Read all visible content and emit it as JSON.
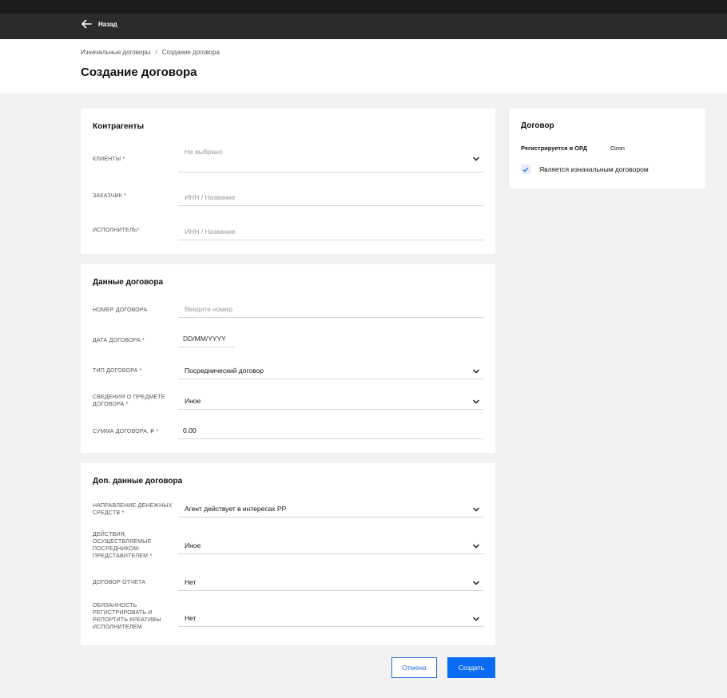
{
  "nav": {
    "back_label": "Назад"
  },
  "breadcrumb": {
    "items": [
      "Изначальные договоры",
      "Создание договора"
    ],
    "separator": "/"
  },
  "page_title": "Создание договора",
  "counterparties": {
    "title": "Контрагенты",
    "clients": {
      "label": "КЛИЕНТЫ *",
      "placeholder": "Не выбрано"
    },
    "customer": {
      "label": "ЗАКАЗЧИК *",
      "placeholder": "ИНН / Название"
    },
    "executor": {
      "label": "ИСПОЛНИТЕЛЬ*",
      "placeholder": "ИНН / Название"
    }
  },
  "contract_data": {
    "title": "Данные договора",
    "number": {
      "label": "НОМЕР ДОГОВОРА",
      "placeholder": "Введите номер"
    },
    "date": {
      "label": "ДАТА ДОГОВОРА *",
      "value": "DD/MM/YYYY"
    },
    "type": {
      "label": "ТИП ДОГОВОРА *",
      "value": "Посреднический договор"
    },
    "subject": {
      "label": "СВЕДЕНИЯ О ПРЕДМЕТЕ ДОГОВОРА *",
      "value": "Иное"
    },
    "amount": {
      "label": "СУММА ДОГОВОРА, ₽ *",
      "value": "0.00"
    }
  },
  "extra_data": {
    "title": "Доп. данные договора",
    "money_direction": {
      "label": "НАПРАВЛЕНИЕ ДЕНЕЖНЫХ СРЕДСТВ *",
      "value": "Агент действует в интересах РР"
    },
    "agent_actions": {
      "label": "ДЕЙСТВИЯ, ОСУЩЕСТВЛЯЕМЫЕ ПОСРЕДНИКОМ-ПРЕДСТАВИТЕЛЕМ *",
      "value": "Иное"
    },
    "report_contract": {
      "label": "ДОГОВОР ОТЧЕТА",
      "value": "Нет"
    },
    "obligation": {
      "label": "ОБЯЗАННОСТЬ РЕГИСТРИРОВАТЬ И РЕПОРТИТЬ КРЕАТИВЫ ИСПОЛНИТЕЛЕМ",
      "value": "Нет"
    }
  },
  "sidebar": {
    "title": "Договор",
    "ord_label": "Регистрируется в ОРД",
    "ord_value": "Ozon",
    "initial_checkbox_label": "Является изначальным договором",
    "initial_checked": true
  },
  "actions": {
    "cancel_label": "Отмена",
    "create_label": "Создать"
  },
  "colors": {
    "accent": "#0a6bf5",
    "topbar": "#2b2b2b",
    "background": "#f2f2f2"
  }
}
